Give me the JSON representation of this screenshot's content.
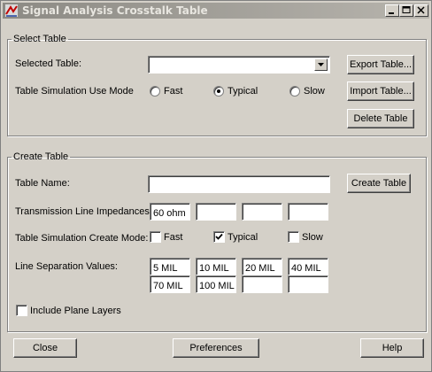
{
  "window": {
    "title": "Signal Analysis Crosstalk Table"
  },
  "select_table": {
    "legend": "Select Table",
    "selected_table_label": "Selected Table:",
    "selected_table_value": "",
    "use_mode_label": "Table Simulation Use Mode",
    "use_mode_options": [
      "Fast",
      "Typical",
      "Slow"
    ],
    "use_mode_selected": "Typical",
    "export_button": "Export Table...",
    "import_button": "Import Table...",
    "delete_button": "Delete Table"
  },
  "create_table": {
    "legend": "Create Table",
    "table_name_label": "Table Name:",
    "table_name_value": "",
    "create_button": "Create Table",
    "impedances_label": "Transmission Line Impedances:",
    "impedances": [
      "60 ohm",
      "",
      "",
      ""
    ],
    "create_mode_label": "Table Simulation Create Mode:",
    "create_mode_options": [
      "Fast",
      "Typical",
      "Slow"
    ],
    "create_mode_checked": [
      false,
      true,
      false
    ],
    "separation_label": "Line Separation Values:",
    "separation_row1": [
      "5 MIL",
      "10 MIL",
      "20 MIL",
      "40 MIL"
    ],
    "separation_row2": [
      "70 MIL",
      "100 MIL",
      "",
      ""
    ],
    "include_plane_label": "Include Plane Layers",
    "include_plane_checked": false
  },
  "footer": {
    "close_button": "Close",
    "preferences_button": "Preferences",
    "help_button": "Help"
  }
}
